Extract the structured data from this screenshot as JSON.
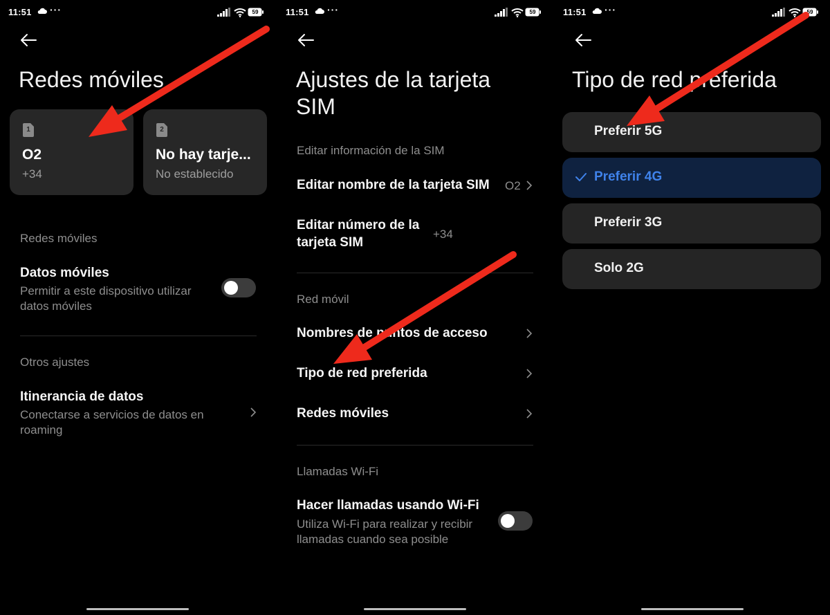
{
  "status_bar": {
    "time": "11:51",
    "dots": "···",
    "battery": "59"
  },
  "screen1": {
    "title": "Redes móviles",
    "sim_cards": [
      {
        "slot": "1",
        "name": "O2",
        "sub": "+34"
      },
      {
        "slot": "2",
        "name": "No hay tarje...",
        "sub": "No establecido"
      }
    ],
    "section_mobile": "Redes móviles",
    "mobile_data": {
      "title": "Datos móviles",
      "sub_line1": "Permitir a este dispositivo utilizar",
      "sub_line2": "datos móviles",
      "enabled": false
    },
    "section_other": "Otros ajustes",
    "roaming": {
      "title": "Itinerancia de datos",
      "sub_line1": "Conectarse a servicios de datos en",
      "sub_line2": "roaming"
    }
  },
  "screen2": {
    "title_line1": "Ajustes de la tarjeta",
    "title_line2": "SIM",
    "section_edit": "Editar información de la SIM",
    "edit_name": {
      "title": "Editar nombre de la tarjeta SIM",
      "value": "O2"
    },
    "edit_number": {
      "title_line1": "Editar número de la",
      "title_line2": "tarjeta SIM",
      "value": "+34"
    },
    "section_network": "Red móvil",
    "apn": "Nombres de puntos de acceso",
    "preferred_network": "Tipo de red preferida",
    "mobile_networks": "Redes móviles",
    "section_wifi": "Llamadas Wi-Fi",
    "wifi_calling": {
      "title": "Hacer llamadas usando Wi-Fi",
      "sub_line1": "Utiliza Wi-Fi para realizar y recibir",
      "sub_line2": "llamadas cuando sea posible",
      "enabled": false
    }
  },
  "screen3": {
    "title": "Tipo de red preferida",
    "options": [
      {
        "label": "Preferir 5G",
        "selected": false
      },
      {
        "label": "Preferir 4G",
        "selected": true
      },
      {
        "label": "Preferir 3G",
        "selected": false
      },
      {
        "label": "Solo 2G",
        "selected": false
      }
    ]
  },
  "colors": {
    "background": "#000000",
    "card": "#272727",
    "selected_bg": "#0f2240",
    "accent_blue": "#3f82ea",
    "annotation_arrow": "#ee2a1c",
    "secondary_text": "#8e8e8e"
  }
}
